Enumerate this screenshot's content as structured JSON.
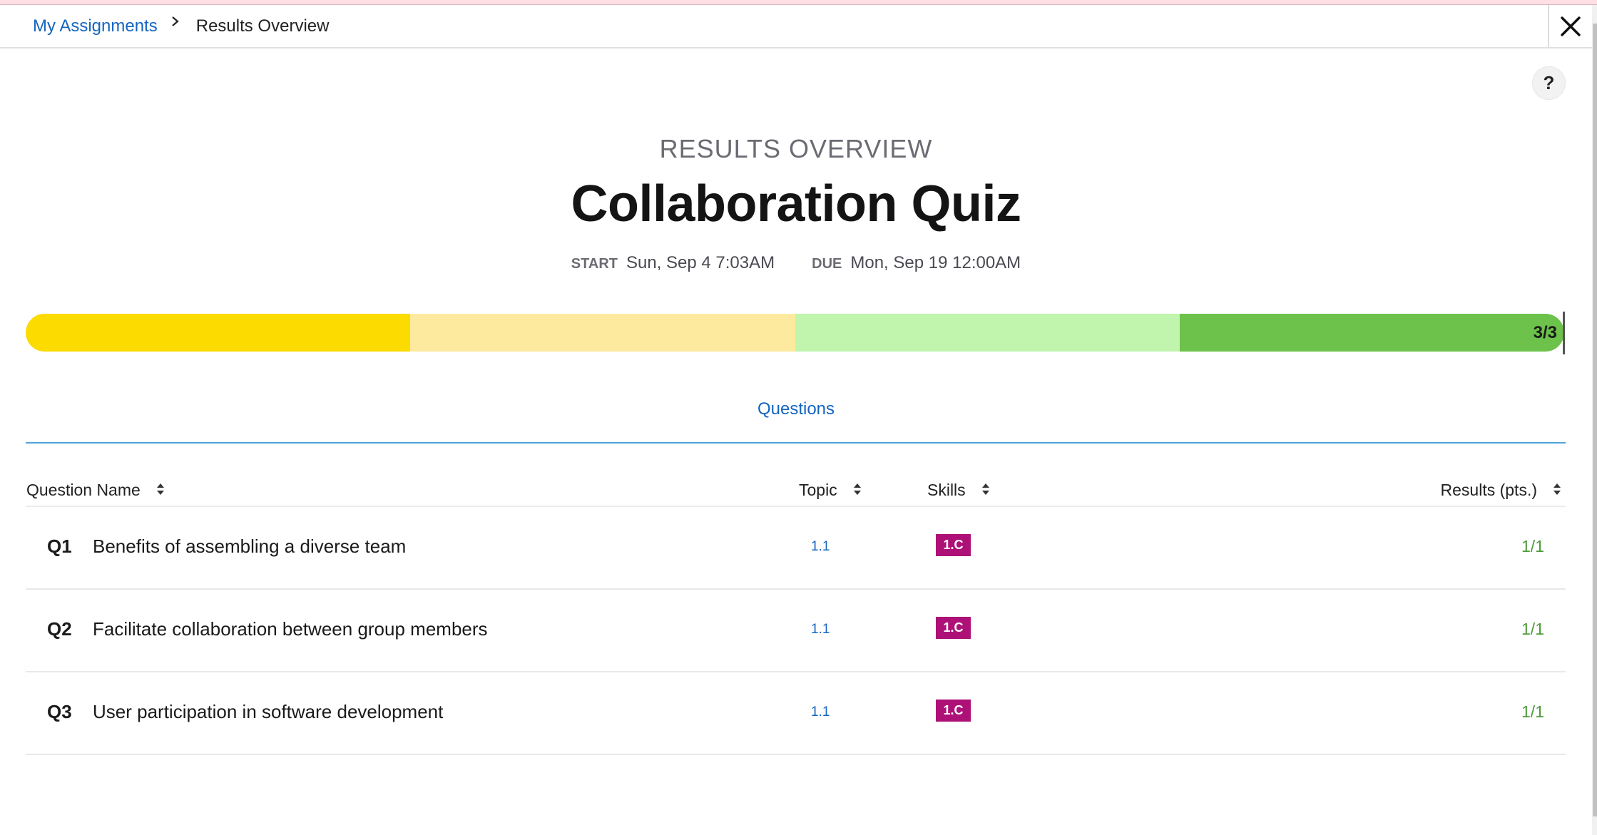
{
  "breadcrumb": {
    "parent": "My Assignments",
    "current": "Results Overview"
  },
  "header": {
    "close_icon": "close-x-icon",
    "help_label": "?"
  },
  "hero": {
    "eyebrow": "RESULTS OVERVIEW",
    "title": "Collaboration Quiz",
    "start_label": "START",
    "start_value": "Sun, Sep 4 7:03AM",
    "due_label": "DUE",
    "due_value": "Mon, Sep 19 12:00AM"
  },
  "progress": {
    "score_label": "3/3",
    "score": 3,
    "max": 3,
    "segments": [
      {
        "color": "#fcdb00"
      },
      {
        "color": "#feea9f"
      },
      {
        "color": "#c1f5ad"
      },
      {
        "color": "#6cc24a"
      }
    ]
  },
  "tabs": [
    {
      "label": "Questions",
      "active": true
    }
  ],
  "table": {
    "columns": [
      "Question Name",
      "Topic",
      "Skills",
      "Results (pts.)"
    ],
    "rows": [
      {
        "num": "Q1",
        "name": "Benefits of assembling a diverse team",
        "topic": "1.1",
        "skill": "1.C",
        "result": "1/1"
      },
      {
        "num": "Q2",
        "name": "Facilitate collaboration between group members",
        "topic": "1.1",
        "skill": "1.C",
        "result": "1/1"
      },
      {
        "num": "Q3",
        "name": "User participation in software development",
        "topic": "1.1",
        "skill": "1.C",
        "result": "1/1"
      }
    ]
  },
  "colors": {
    "link": "#1565c0",
    "skill_badge": "#ad1177",
    "result_green": "#4c9a3a",
    "tab_underline": "#4ea3dc"
  }
}
